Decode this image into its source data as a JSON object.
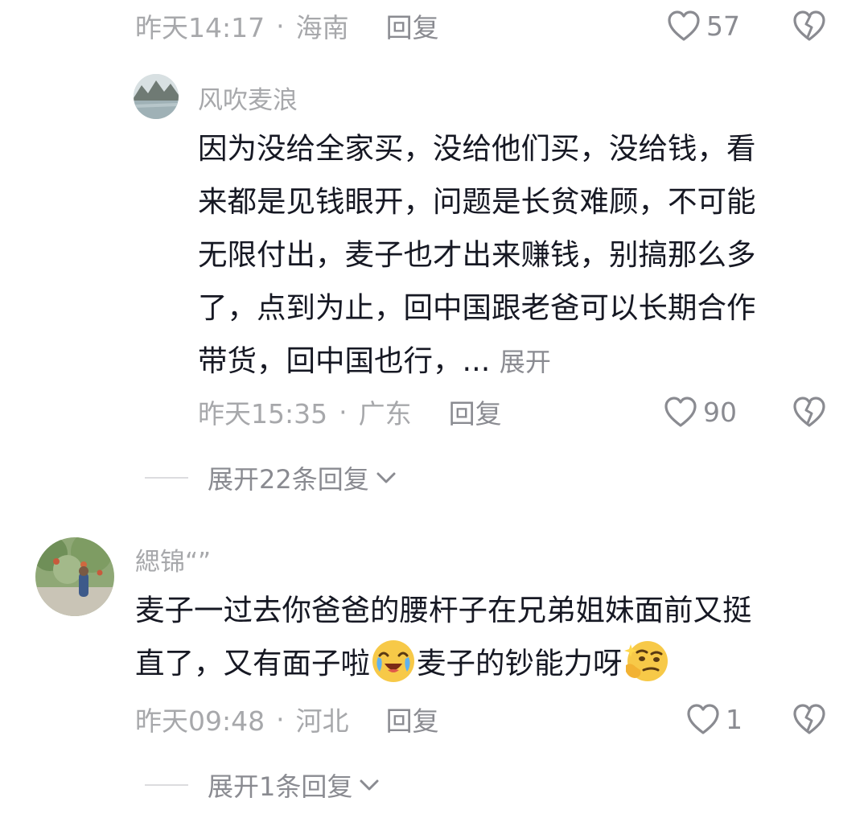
{
  "comments": [
    {
      "meta": {
        "time": "昨天14:17",
        "location": "海南",
        "reply": "回复"
      },
      "likes": "57"
    },
    {
      "username": "风吹麦浪",
      "lines": [
        "因为没给全家买，没给他们买，没给钱，看",
        "来都是见钱眼开，问题是长贫难顾，不可能",
        "无限付出，麦子也才出来赚钱，别搞那么多",
        "了，点到为止，回中国跟老爸可以长期合作",
        "带货，回中国也行，..."
      ],
      "expand": "展开",
      "meta": {
        "time": "昨天15:35",
        "location": "广东",
        "reply": "回复"
      },
      "likes": "90",
      "more_replies": "展开22条回复"
    },
    {
      "username": "緦锦“”",
      "line1": "麦子一过去你爸爸的腰杆子在兄弟姐妹面前又挺",
      "line2_a": "直了，又有面子啦",
      "line2_b": "麦子的钞能力呀",
      "emoji_1": "crying-laughing-emoji",
      "emoji_2": "thinking-emoji",
      "meta": {
        "time": "昨天09:48",
        "location": "河北",
        "reply": "回复"
      },
      "likes": "1",
      "more_replies": "展开1条回复"
    }
  ],
  "separator": "·",
  "colors": {
    "text_primary": "#161823",
    "text_meta": "#a7a8ab",
    "text_link": "#8a8b91",
    "background": "#ffffff"
  }
}
